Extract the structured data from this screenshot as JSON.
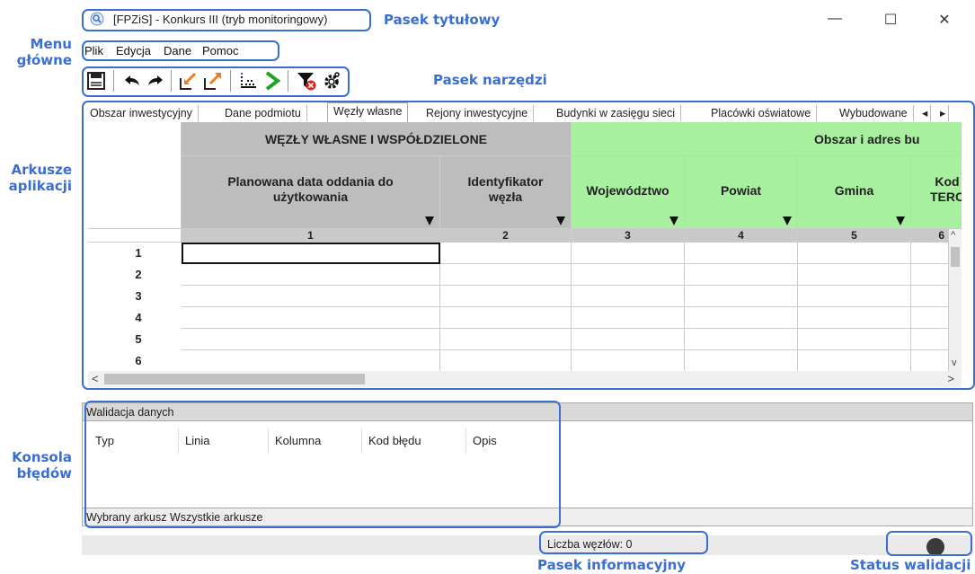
{
  "window": {
    "title": "[FPZiS] - Konkurs III (tryb monitoringowy)",
    "controls": [
      "—",
      "☐",
      "✕"
    ]
  },
  "menu": [
    "Plik",
    "Edycja",
    "Dane",
    "Pomoc"
  ],
  "toolbar": {
    "icons": [
      "save-icon",
      "undo-icon",
      "redo-icon",
      "import-icon",
      "export-icon",
      "data-points-icon",
      "run-icon",
      "filter-clear-icon",
      "settings-icon"
    ]
  },
  "tabs": {
    "items": [
      "Obszar inwestycyjny",
      "Dane podmiotu",
      "Węzły własne",
      "Rejony inwestycyjne",
      "Budynki w zasięgu sieci",
      "Placówki oświatowe",
      "Wybudowane"
    ],
    "active": "Węzły własne",
    "scroll_left": "◂",
    "scroll_right": "▸"
  },
  "grid": {
    "group_left": "WĘZŁY WŁASNE I WSPÓŁDZIELONE",
    "group_right": "Obszar i adres bu",
    "columns": [
      {
        "label": "Planowana data oddania do użytkowania",
        "num": "1"
      },
      {
        "label": "Identyfikator węzła",
        "num": "2"
      },
      {
        "label": "Województwo",
        "num": "3"
      },
      {
        "label": "Powiat",
        "num": "4"
      },
      {
        "label": "Gmina",
        "num": "5"
      },
      {
        "label": "Kod TERC",
        "num": "6"
      }
    ],
    "rows": [
      "1",
      "2",
      "3",
      "4",
      "5",
      "6"
    ],
    "scroll_up": "^",
    "scroll_down": "v",
    "scroll_left": "<",
    "scroll_right": ">"
  },
  "console": {
    "title": "Walidacja danych",
    "columns": [
      "Typ",
      "Linia",
      "Kolumna",
      "Kod błędu",
      "Opis"
    ],
    "footer_label": "Wybrany arkusz",
    "footer_value": "Wszystkie arkusze"
  },
  "status": {
    "nodes": "Liczba węzłów: 0"
  },
  "annotations": {
    "title_bar": "Pasek tytułowy",
    "main_menu": "Menu główne",
    "toolbar": "Pasek narzędzi",
    "sheets": "Arkusze aplikacji",
    "console": "Konsola błędów",
    "info_bar": "Pasek informacyjny",
    "validation_status": "Status walidacji"
  },
  "colors": {
    "annotation": "#3a6fd0",
    "gray_header": "#bdbdbd",
    "green_header": "#a8f0a0"
  }
}
